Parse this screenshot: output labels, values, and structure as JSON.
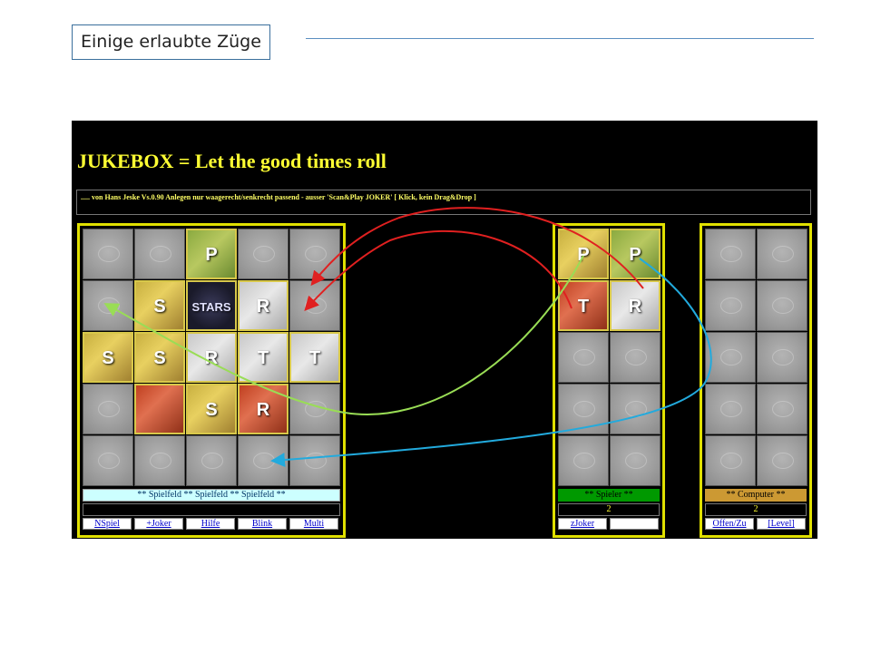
{
  "slide": {
    "title": "Einige erlaubte Züge"
  },
  "game": {
    "title": "JUKEBOX = Let the good times roll",
    "subtitle": "..... von Hans Jeske Vs.0.90 Anlegen nur waagerecht/senkrecht passend - ausser 'Scan&Play JOKER'  [ Klick, kein Drag&Drop ]"
  },
  "main": {
    "status_label": "** Spielfeld ** Spielfeld ** Spielfeld **",
    "buttons": [
      "NSpiel",
      "+Joker",
      "Hilfe",
      "Blink",
      "Multi"
    ],
    "cards": [
      {
        "row": 0,
        "col": 2,
        "tint": "green",
        "mark": "P"
      },
      {
        "row": 1,
        "col": 1,
        "tint": "gold",
        "mark": "S"
      },
      {
        "row": 1,
        "col": 2,
        "tint": "dark",
        "mark": "STARS"
      },
      {
        "row": 1,
        "col": 3,
        "tint": "grey",
        "mark": "R"
      },
      {
        "row": 2,
        "col": 0,
        "tint": "gold",
        "mark": "S"
      },
      {
        "row": 2,
        "col": 1,
        "tint": "gold",
        "mark": "S"
      },
      {
        "row": 2,
        "col": 2,
        "tint": "grey",
        "mark": "R"
      },
      {
        "row": 2,
        "col": 3,
        "tint": "grey",
        "mark": "T"
      },
      {
        "row": 2,
        "col": 4,
        "tint": "grey",
        "mark": "T"
      },
      {
        "row": 3,
        "col": 1,
        "tint": "red",
        "mark": ""
      },
      {
        "row": 3,
        "col": 2,
        "tint": "gold",
        "mark": "S"
      },
      {
        "row": 3,
        "col": 3,
        "tint": "red",
        "mark": "R"
      }
    ]
  },
  "spieler": {
    "status_label": "** Spieler **",
    "count": "2",
    "buttons": [
      "zJoker",
      ""
    ],
    "cards": [
      {
        "row": 0,
        "col": 0,
        "tint": "gold",
        "mark": "P"
      },
      {
        "row": 0,
        "col": 1,
        "tint": "green",
        "mark": "P"
      },
      {
        "row": 1,
        "col": 0,
        "tint": "red",
        "mark": "T"
      },
      {
        "row": 1,
        "col": 1,
        "tint": "grey",
        "mark": "R"
      }
    ]
  },
  "computer": {
    "status_label": "** Computer **",
    "count": "2",
    "buttons": [
      "Offen/Zu",
      "[Level]"
    ]
  },
  "arrows": {
    "colors": {
      "red": "#e02020",
      "green": "#99dd55",
      "blue": "#22aadd"
    }
  }
}
